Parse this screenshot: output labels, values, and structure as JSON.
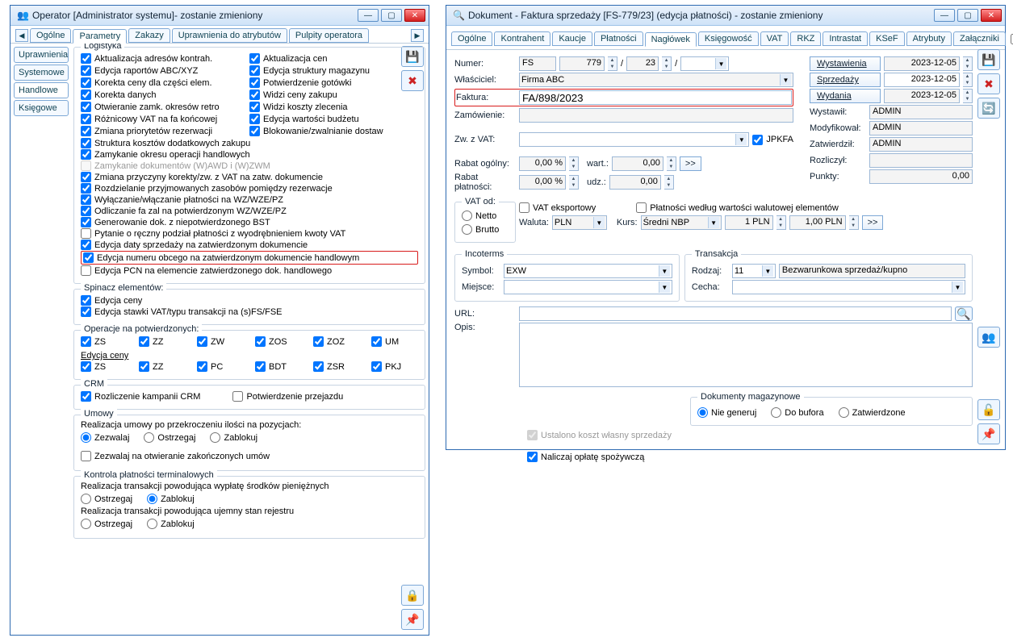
{
  "op_window": {
    "title": "Operator [Administrator systemu]- zostanie zmieniony",
    "tabs": [
      "Ogólne",
      "Parametry",
      "Zakazy",
      "Uprawnienia do atrybutów",
      "Pulpity operatora"
    ],
    "active_tab": "Parametry",
    "side_tabs": [
      "Uprawnienia",
      "Systemowe",
      "Handlowe",
      "Księgowe"
    ],
    "active_side": "Handlowe",
    "logistyka_legend": "Logistyka",
    "logistyka_left": [
      {
        "label": "Aktualizacja adresów kontrah.",
        "checked": true
      },
      {
        "label": "Edycja raportów ABC/XYZ",
        "checked": true
      },
      {
        "label": "Korekta ceny dla części elem.",
        "checked": true
      },
      {
        "label": "Korekta danych",
        "checked": true
      },
      {
        "label": "Otwieranie zamk. okresów retro",
        "checked": true
      },
      {
        "label": "Różnicowy VAT na fa końcowej",
        "checked": true
      },
      {
        "label": "Zmiana priorytetów rezerwacji",
        "checked": true
      }
    ],
    "logistyka_right": [
      {
        "label": "Aktualizacja cen",
        "checked": true
      },
      {
        "label": "Edycja struktury magazynu",
        "checked": true
      },
      {
        "label": "Potwierdzenie gotówki",
        "checked": true
      },
      {
        "label": "Widzi ceny zakupu",
        "checked": true
      },
      {
        "label": "Widzi koszty zlecenia",
        "checked": true
      },
      {
        "label": "Edycja wartości budżetu",
        "checked": true
      },
      {
        "label": "Blokowanie/zwalnianie dostaw",
        "checked": true
      }
    ],
    "logistyka_full": [
      {
        "label": "Struktura kosztów dodatkowych zakupu",
        "checked": true
      },
      {
        "label": "Zamykanie okresu operacji handlowych",
        "checked": true
      },
      {
        "label": "Zamykanie dokumentów (W)AWD i (W)ZWM",
        "checked": false,
        "disabled": true
      },
      {
        "label": "Zmiana przyczyny korekty/zw. z VAT na zatw. dokumencie",
        "checked": true
      },
      {
        "label": "Rozdzielanie przyjmowanych zasobów pomiędzy rezerwacje",
        "checked": true
      },
      {
        "label": "Wyłączanie/włączanie płatności na WZ/WZE/PZ",
        "checked": true
      },
      {
        "label": "Odliczanie fa zal na potwierdzonym WZ/WZE/PZ",
        "checked": true
      },
      {
        "label": "Generowanie dok. z niepotwierdzonego BST",
        "checked": true
      },
      {
        "label": "Pytanie o ręczny podział płatności z wyodrębnieniem kwoty VAT",
        "checked": false
      },
      {
        "label": "Edycja daty sprzedaży na zatwierdzonym dokumencie",
        "checked": true
      },
      {
        "label": "Edycja numeru obcego na zatwierdzonym dokumencie handlowym",
        "checked": true,
        "highlight": true
      },
      {
        "label": "Edycja PCN na elemencie zatwierdzonego dok. handlowego",
        "checked": false
      }
    ],
    "spinacz_legend": "Spinacz elementów:",
    "spinacz": [
      {
        "label": "Edycja ceny",
        "checked": true
      },
      {
        "label": "Edycja stawki VAT/typu transakcji na (s)FS/FSE",
        "checked": true
      }
    ],
    "ops_legend": "Operacje na potwierdzonych:",
    "ops_row1": [
      "ZS",
      "ZZ",
      "ZW",
      "ZOS",
      "ZOZ",
      "UM"
    ],
    "ops_sub_legend": "Edycja ceny",
    "ops_row2": [
      "ZS",
      "ZZ",
      "PC",
      "BDT",
      "ZSR",
      "PKJ"
    ],
    "crm_legend": "CRM",
    "crm": [
      {
        "label": "Rozliczenie kampanii CRM",
        "checked": true
      },
      {
        "label": "Potwierdzenie przejazdu",
        "checked": false
      }
    ],
    "umowy_legend": "Umowy",
    "umowy_label": "Realizacja umowy po przekroczeniu ilości na pozycjach:",
    "umowy_radio": [
      {
        "label": "Zezwalaj",
        "checked": true
      },
      {
        "label": "Ostrzegaj",
        "checked": false
      },
      {
        "label": "Zablokuj",
        "checked": false
      }
    ],
    "umowy_chk": {
      "label": "Zezwalaj na otwieranie zakończonych umów",
      "checked": false
    },
    "kontrola_legend": "Kontrola płatności terminalowych",
    "kontrola1_label": "Realizacja transakcji powodująca wypłatę środków pieniężnych",
    "kontrola1_radio": [
      {
        "label": "Ostrzegaj",
        "checked": false
      },
      {
        "label": "Zablokuj",
        "checked": true
      }
    ],
    "kontrola2_label": "Realizacja transakcji powodująca ujemny stan rejestru",
    "kontrola2_radio": [
      {
        "label": "Ostrzegaj",
        "checked": false
      },
      {
        "label": "Zablokuj",
        "checked": false
      }
    ]
  },
  "doc_window": {
    "title": "Dokument - Faktura sprzedaży [FS-779/23] (edycja płatności) - zostanie zmieniony",
    "tabs": [
      "Ogólne",
      "Kontrahent",
      "Kaucje",
      "Płatności",
      "Nagłówek",
      "Księgowość",
      "VAT",
      "RKZ",
      "Intrastat",
      "KSeF",
      "Atrybuty",
      "Załączniki"
    ],
    "active_tab": "Nagłówek",
    "do_bufora": "Do bufora",
    "numer_label": "Numer:",
    "numer_prefix": "FS",
    "numer_1": "779",
    "numer_2": "23",
    "wlasciciel_label": "Właściciel:",
    "wlasciciel": "Firma ABC",
    "faktura_label": "Faktura:",
    "faktura": "FA/898/2023",
    "zamowienie_label": "Zamówienie:",
    "zw_vat_label": "Zw. z VAT:",
    "jpkfa": "JPKFA",
    "rabat_og_label": "Rabat ogólny:",
    "rabat_og": "0,00 %",
    "wart_label": "wart.:",
    "wart_val": "0,00",
    "rabat_pl_label": "Rabat płatności:",
    "rabat_pl": "0,00 %",
    "udz_label": "udz.:",
    "udz_val": "0,00",
    "gobtn": ">>",
    "vat_od_legend": "VAT od:",
    "vat_netto": "Netto",
    "vat_brutto": "Brutto",
    "vat_eksport": "VAT eksportowy",
    "platnosci_walut": "Płatności według wartości walutowej elementów",
    "waluta_label": "Waluta:",
    "waluta": "PLN",
    "kurs_label": "Kurs:",
    "kurs": "Średni NBP",
    "kurs_pln1": "1 PLN",
    "kurs_pln2": "1,00 PLN",
    "incoterms_legend": "Incoterms",
    "symbol_label": "Symbol:",
    "symbol": "EXW",
    "miejsce_label": "Miejsce:",
    "transakcja_legend": "Transakcja",
    "rodzaj_label": "Rodzaj:",
    "rodzaj": "11",
    "rodzaj_desc": "Bezwarunkowa sprzedaż/kupno",
    "cecha_label": "Cecha:",
    "url_label": "URL:",
    "opis_label": "Opis:",
    "date_wyst_btn": "Wystawienia",
    "date_wyst": "2023-12-05",
    "date_sprz_btn": "Sprzedaży",
    "date_sprz": "2023-12-05",
    "date_wyd_btn": "Wydania",
    "date_wyd": "2023-12-05",
    "wystawil_label": "Wystawił:",
    "wystawil": "ADMIN",
    "modyf_label": "Modyfikował:",
    "modyf": "ADMIN",
    "zatw_label": "Zatwierdził:",
    "zatw": "ADMIN",
    "rozl_label": "Rozliczył:",
    "punkty_label": "Punkty:",
    "punkty": "0,00",
    "dok_mag_legend": "Dokumenty magazynowe",
    "dok_mag": [
      {
        "label": "Nie generuj",
        "checked": true
      },
      {
        "label": "Do bufora",
        "checked": false
      },
      {
        "label": "Zatwierdzone",
        "checked": false
      }
    ],
    "ustalono": "Ustalono koszt własny sprzedaży",
    "naliczaj": "Naliczaj opłatę spożywczą"
  }
}
